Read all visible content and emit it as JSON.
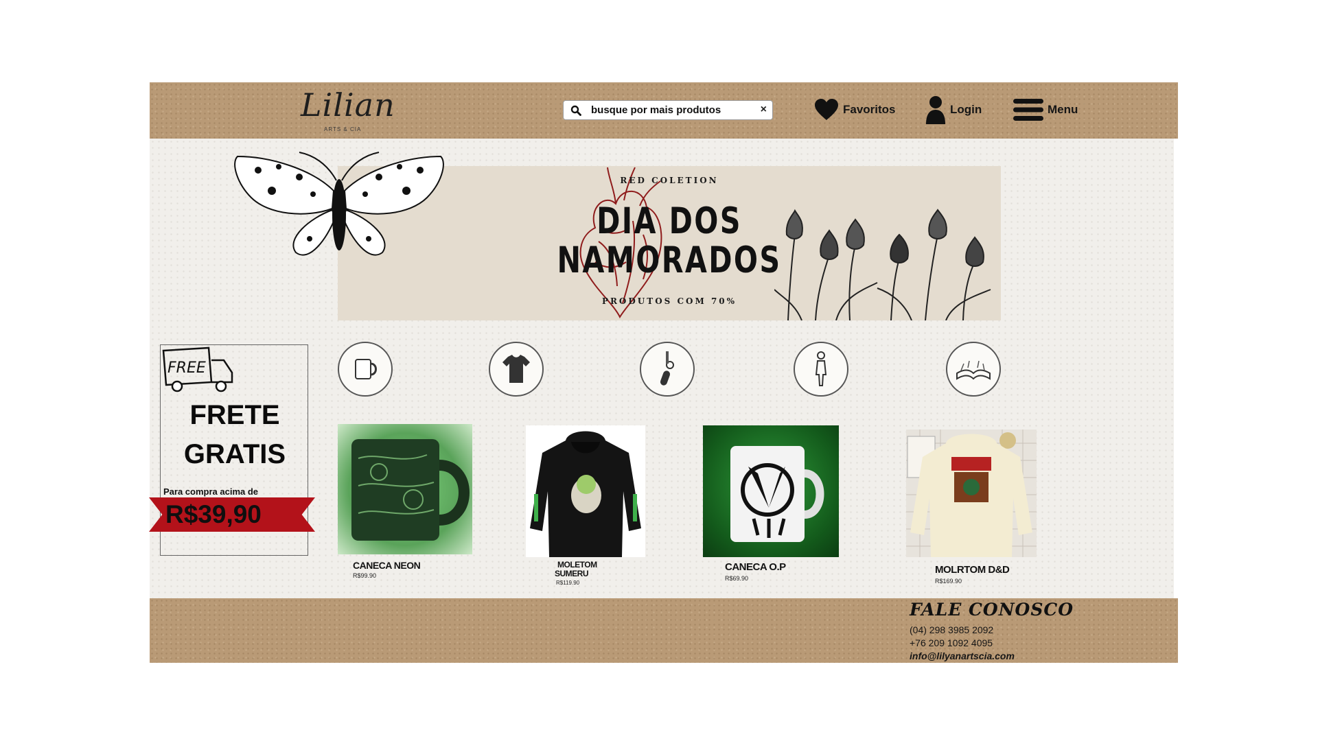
{
  "header": {
    "logo_text": "Lilian",
    "logo_subtitle": "ARTS & CIA",
    "search": {
      "value": "busque por mais produtos",
      "clear_label": "×"
    },
    "favorites_label": "Favoritos",
    "login_label": "Login",
    "menu_label": "Menu"
  },
  "banner": {
    "eyebrow": "RED COLETION",
    "title_line1": "DIA DOS",
    "title_line2": "NAMORADOS",
    "subtitle": "PRODUTOS COM 70%"
  },
  "shipping": {
    "truck_text": "FREE",
    "title_line1": "FRETE",
    "title_line2": "GRATIS",
    "note": "Para compra acima de",
    "amount": "R$39,90"
  },
  "categories": [
    {
      "icon": "mug-icon"
    },
    {
      "icon": "tshirt-icon"
    },
    {
      "icon": "keychain-icon"
    },
    {
      "icon": "figure-icon"
    },
    {
      "icon": "book-icon"
    }
  ],
  "products": [
    {
      "name": "CANECA NEON",
      "price": "R$99.90"
    },
    {
      "name_line1": "MOLETOM",
      "name_line2": "SUMERU",
      "price": "R$119.90"
    },
    {
      "name": "CANECA O.P",
      "price": "R$69.90"
    },
    {
      "name": "MOLRTOM D&D",
      "price": "R$169.90"
    }
  ],
  "footer": {
    "title": "FALE CONOSCO",
    "phone1": "(04) 298 3985 2092",
    "phone2": "+76 209 1092 4095",
    "email": "info@lilyanartscia.com"
  },
  "colors": {
    "kraft": "#b99a76",
    "ribbon": "#b3121a",
    "page": "#f1efeb"
  }
}
